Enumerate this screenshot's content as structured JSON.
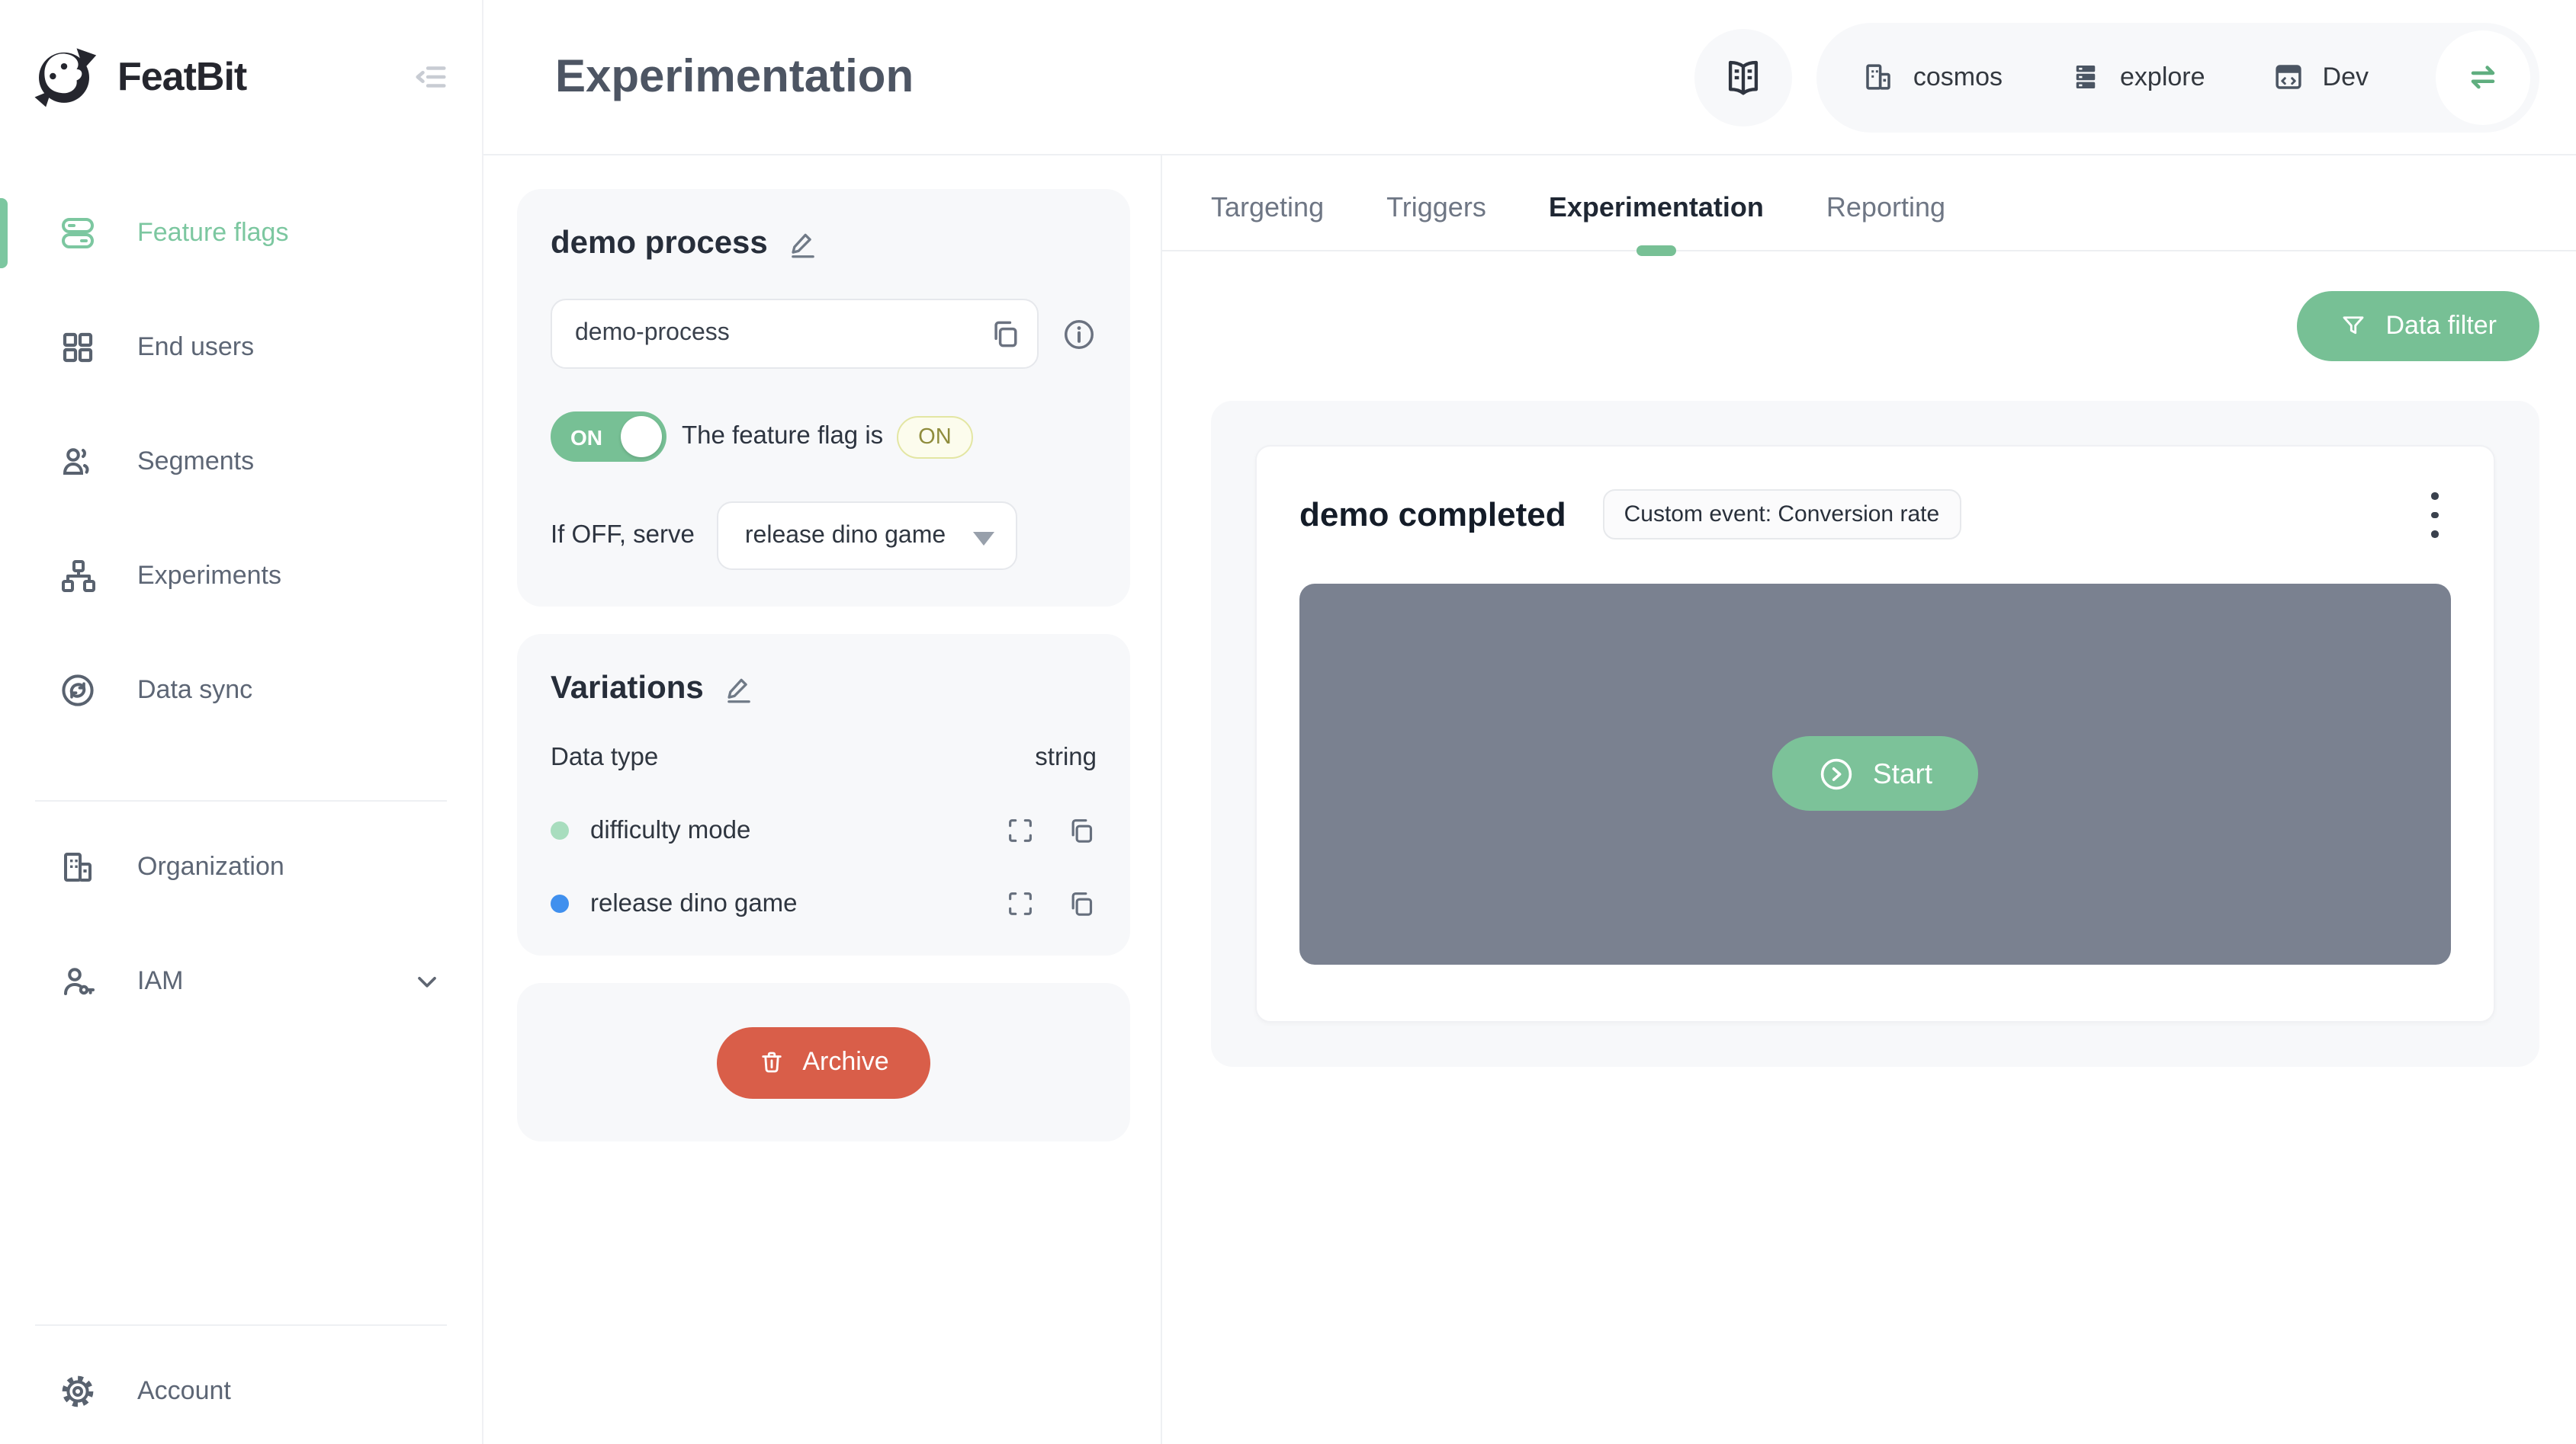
{
  "brand": {
    "name": "FeatBit"
  },
  "sidebar": {
    "items": [
      {
        "label": "Feature flags",
        "icon": "feature-flags-toggles-icon",
        "active": true
      },
      {
        "label": "End users",
        "icon": "grid-icon",
        "active": false
      },
      {
        "label": "Segments",
        "icon": "person-icon",
        "active": false
      },
      {
        "label": "Experiments",
        "icon": "sitemap-icon",
        "active": false
      },
      {
        "label": "Data sync",
        "icon": "sync-icon",
        "active": false
      },
      {
        "label": "Organization",
        "icon": "building-icon",
        "active": false
      },
      {
        "label": "IAM",
        "icon": "person-key-icon",
        "active": false
      }
    ],
    "account_label": "Account"
  },
  "header": {
    "title": "Experimentation",
    "workspace": {
      "project_label": "cosmos",
      "env_group_label": "explore",
      "env_label": "Dev"
    }
  },
  "tabs": {
    "items": [
      "Targeting",
      "Triggers",
      "Experimentation",
      "Reporting"
    ],
    "active": "Experimentation"
  },
  "flag": {
    "name": "demo process",
    "key": "demo-process",
    "toggle_state": "ON",
    "status_prefix": "The feature flag is",
    "status_badge": "ON",
    "off_serve_label": "If OFF, serve",
    "off_serve_value": "release dino game"
  },
  "variations": {
    "title": "Variations",
    "data_type_label": "Data type",
    "data_type_value": "string",
    "items": [
      {
        "name": "difficulty mode",
        "dot_color": "#a8ddbe",
        "dot_css": "background:#a8ddbe"
      },
      {
        "name": "release dino game",
        "dot_color": "#4090ee",
        "dot_css": "background:#4090ee"
      }
    ]
  },
  "archive": {
    "label": "Archive"
  },
  "experimentation": {
    "data_filter_label": "Data filter",
    "card_title": "demo completed",
    "event_badge": "Custom event: Conversion rate",
    "start_label": "Start"
  },
  "colors": {
    "accent_green": "#77c095",
    "sidebar_active_green": "#7cc7a0",
    "archive_red": "#d95e49",
    "panel_gray": "#7a8190",
    "status_badge_text": "#8f8c3c",
    "variation_dot_green": "#a8ddbe",
    "variation_dot_blue": "#4090ee"
  }
}
